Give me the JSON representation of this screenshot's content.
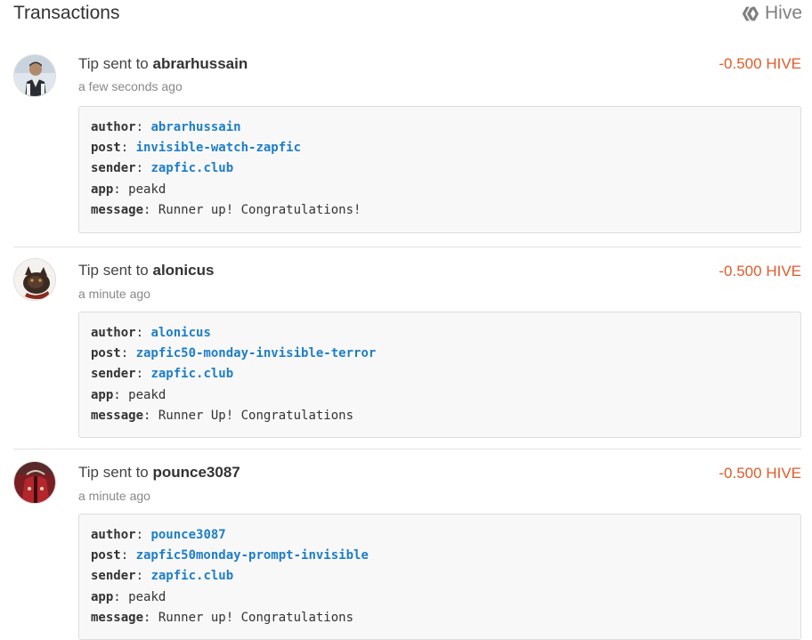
{
  "header": {
    "title": "Transactions",
    "brand_label": "Hive",
    "brand_icon": "hive-logo-icon"
  },
  "colors": {
    "amount": "#e35a2b",
    "link": "#1e7ec8",
    "memo_bg": "#f8f8f8"
  },
  "transactions": [
    {
      "action_prefix": "Tip sent to",
      "recipient": "abrarhussain",
      "amount": "-0.500 HIVE",
      "time": "a few seconds ago",
      "memo": {
        "author_key": "author",
        "author": "abrarhussain",
        "post_key": "post",
        "post": "invisible-watch-zapfic",
        "sender_key": "sender",
        "sender": "zapfic.club",
        "app_key": "app",
        "app": "peakd",
        "message_key": "message",
        "message": "Runner up! Congratulations!"
      }
    },
    {
      "action_prefix": "Tip sent to",
      "recipient": "alonicus",
      "amount": "-0.500 HIVE",
      "time": "a minute ago",
      "memo": {
        "author_key": "author",
        "author": "alonicus",
        "post_key": "post",
        "post": "zapfic50-monday-invisible-terror",
        "sender_key": "sender",
        "sender": "zapfic.club",
        "app_key": "app",
        "app": "peakd",
        "message_key": "message",
        "message": "Runner Up! Congratulations"
      }
    },
    {
      "action_prefix": "Tip sent to",
      "recipient": "pounce3087",
      "amount": "-0.500 HIVE",
      "time": "a minute ago",
      "memo": {
        "author_key": "author",
        "author": "pounce3087",
        "post_key": "post",
        "post": "zapfic50monday-prompt-invisible",
        "sender_key": "sender",
        "sender": "zapfic.club",
        "app_key": "app",
        "app": "peakd",
        "message_key": "message",
        "message": "Runner up! Congratulations"
      }
    }
  ]
}
